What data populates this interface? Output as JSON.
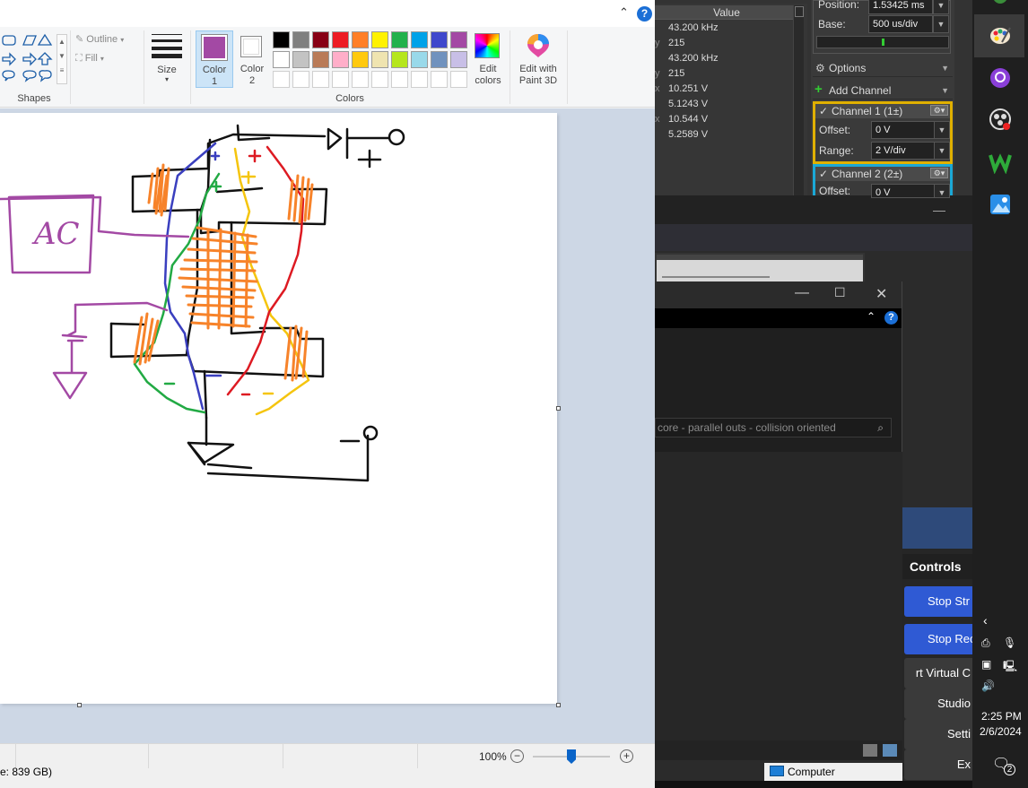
{
  "paint": {
    "ribbon": {
      "shapes_group": "Shapes",
      "outline_label": "Outline",
      "fill_label": "Fill",
      "size_label": "Size",
      "color1_label": "Color 1",
      "color2_label": "Color 2",
      "colors_group": "Colors",
      "edit_colors_label": "Edit colors",
      "edit_paint3d_label": "Edit with Paint 3D",
      "color1_value": "#a349a4",
      "color2_value": "#ffffff",
      "palette_row1": [
        "#000000",
        "#7f7f7f",
        "#880015",
        "#ed1c24",
        "#ff7f27",
        "#fff200",
        "#22b14c",
        "#00a2e8",
        "#3f48cc",
        "#a349a4"
      ],
      "palette_row2": [
        "#ffffff",
        "#c3c3c3",
        "#b97a57",
        "#ffaec9",
        "#ffc90e",
        "#efe4b0",
        "#b5e61d",
        "#99d9ea",
        "#7092be",
        "#c8bfe7"
      ],
      "palette_row3": [
        "#ffffff",
        "#ffffff",
        "#ffffff",
        "#ffffff",
        "#ffffff",
        "#ffffff",
        "#ffffff",
        "#ffffff",
        "#ffffff",
        "#ffffff"
      ]
    },
    "drawing": {
      "box_label": "AC",
      "plus_sign": "+",
      "minus_sign": "−"
    },
    "status": {
      "zoom": "100%",
      "zoom_percent": 100,
      "disk": "e: 839 GB)"
    }
  },
  "scope": {
    "value_header": "Value",
    "values": [
      {
        "mark": "",
        "value": "43.200 kHz"
      },
      {
        "mark": "y",
        "value": "215"
      },
      {
        "mark": "",
        "value": "43.200 kHz"
      },
      {
        "mark": "y",
        "value": "215"
      },
      {
        "mark": "x",
        "value": "10.251 V"
      },
      {
        "mark": "",
        "value": "5.1243 V"
      },
      {
        "mark": "x",
        "value": "10.544 V"
      },
      {
        "mark": "",
        "value": "5.2589 V"
      }
    ],
    "position_label": "Position:",
    "position_value": "1.53425 ms",
    "base_label": "Base:",
    "base_value": "500 us/div",
    "options_label": "Options",
    "add_channel_label": "Add Channel",
    "channel1": {
      "name": "Channel 1 (1±)",
      "offset_label": "Offset:",
      "offset_value": "0 V",
      "range_label": "Range:",
      "range_value": "2 V/div",
      "color": "#e0b000"
    },
    "channel2": {
      "name": "Channel 2 (2±)",
      "offset_label": "Offset:",
      "offset_value": "0 V",
      "color": "#1ba8d6"
    }
  },
  "obs": {
    "search_text": "core - parallel outs - collision oriented",
    "controls_title": "Controls",
    "buttons": [
      "Stop Str",
      "Stop Rec",
      "rt Virtual C",
      "Studio",
      "Setti",
      "Ex"
    ],
    "computer_label": "Computer"
  },
  "taskbar": {
    "time": "2:25 PM",
    "date": "2/6/2024",
    "notification_count": "2"
  }
}
